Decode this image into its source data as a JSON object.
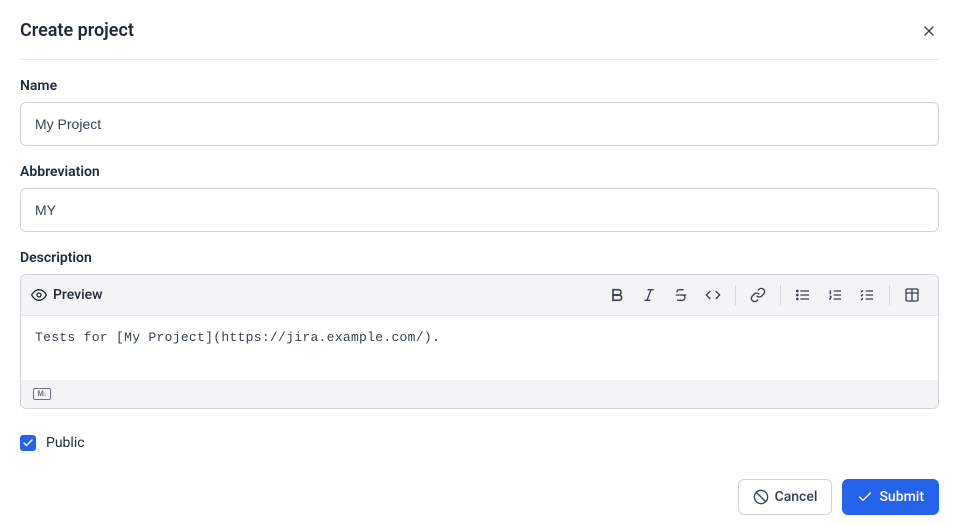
{
  "dialog": {
    "title": "Create project"
  },
  "form": {
    "name_label": "Name",
    "name_value": "My Project",
    "abbr_label": "Abbreviation",
    "abbr_value": "MY",
    "desc_label": "Description",
    "desc_value": "Tests for [My Project](https://jira.example.com/).",
    "preview_label": "Preview",
    "public_label": "Public",
    "public_checked": true
  },
  "buttons": {
    "cancel": "Cancel",
    "submit": "Submit"
  }
}
